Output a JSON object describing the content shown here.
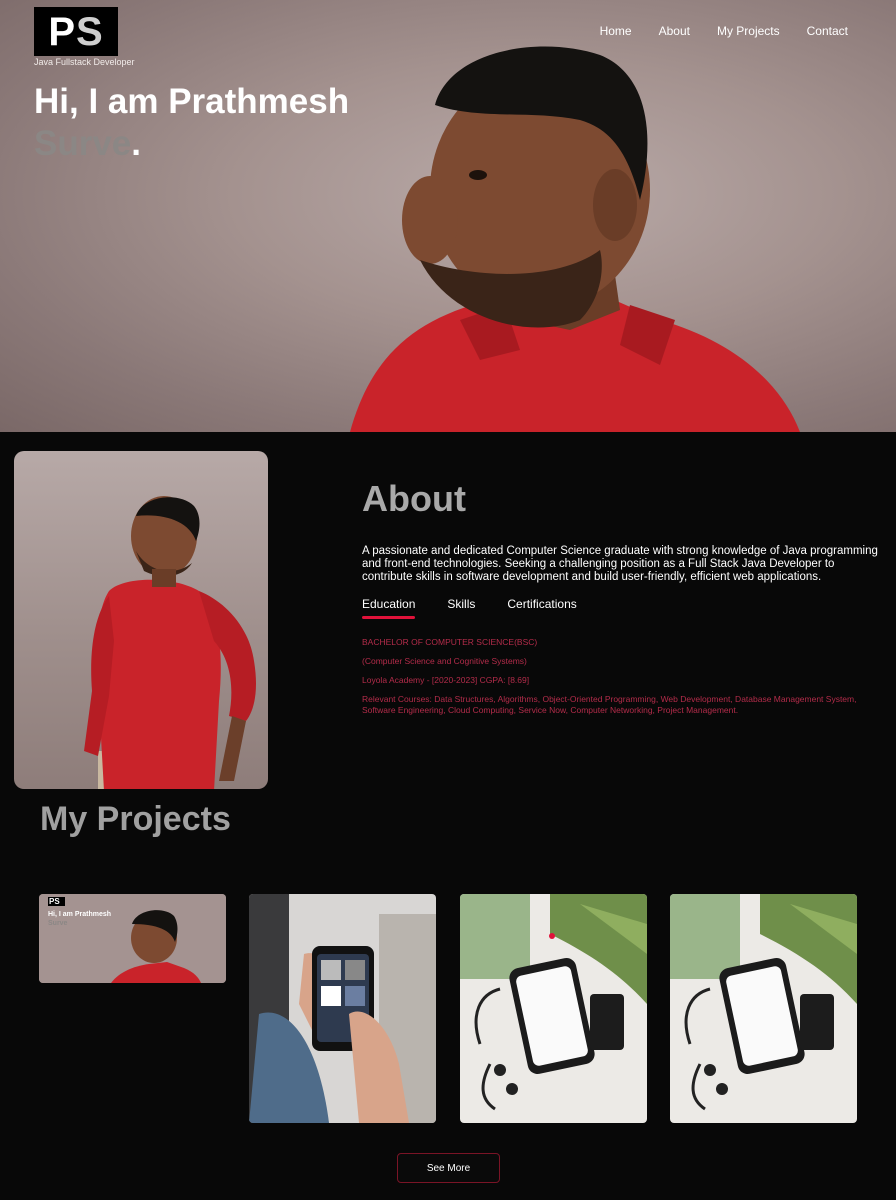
{
  "brand": {
    "logo_p": "P",
    "logo_s": "S",
    "role": "Java Fullstack Developer"
  },
  "nav": {
    "items": [
      "Home",
      "About",
      "My Projects",
      "Contact"
    ]
  },
  "hero": {
    "greeting": "Hi, I am Prathmesh",
    "surname": "Surve",
    "dot": "."
  },
  "about": {
    "title": "About",
    "text": "A passionate and dedicated Computer Science graduate with strong knowledge of Java programming and front-end technologies. Seeking a challenging position as a Full Stack Java Developer to contribute skills in software development and build user-friendly, efficient web applications.",
    "tabs": [
      "Education",
      "Skills",
      "Certifications"
    ],
    "active_tab": "Education",
    "education": [
      "BACHELOR OF COMPUTER SCIENCE(BSC)",
      "(Computer Science and Cognitive Systems)",
      "Loyola Academy - [2020-2023] CGPA: [8.69]",
      "Relevant Courses: Data Structures, Algorithms, Object-Oriented Programming, Web Development, Database Management System, Software Engineering, Cloud Computing, Service Now, Computer Networking, Project Management."
    ]
  },
  "projects": {
    "title": "My Projects",
    "thumb1": {
      "logo": "PS",
      "greeting": "Hi, I am Prathmesh",
      "surname": "Surve"
    },
    "see_more": "See More"
  },
  "colors": {
    "accent": "#e0123a",
    "edu_text": "#b32c4a",
    "bg": "#080808"
  }
}
